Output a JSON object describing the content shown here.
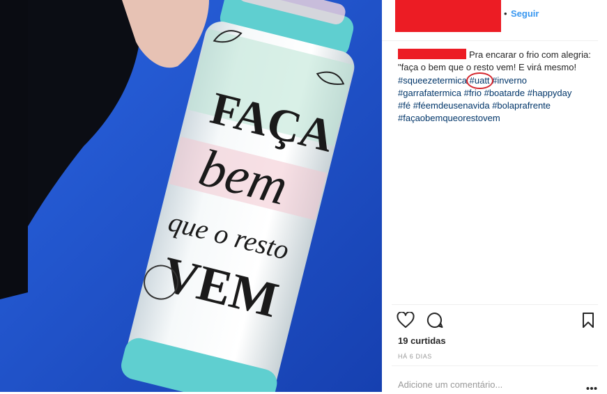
{
  "header": {
    "separator": "•",
    "follow_label": "Seguir"
  },
  "caption": {
    "lines": [
      "Pra encarar o frio com alegria:",
      "\"faça o bem que o resto vem! E virá mesmo!"
    ],
    "hashtags": [
      "#squeezetermica",
      "#uatt",
      "#inverno",
      "#garrafatermica",
      "#frio",
      "#boatarde",
      "#happyday",
      "#fé",
      "#féemdeusenavida",
      "#bolaprafrente",
      "#façaobemqueorestovem"
    ]
  },
  "stats": {
    "likes": "19 curtidas",
    "timestamp": "HÁ 6 DIAS"
  },
  "comment": {
    "placeholder": "Adicione um comentário..."
  },
  "photo": {
    "bottle_text": [
      "FAÇA",
      "bem",
      "que o resto",
      "VEM"
    ]
  },
  "icons": {
    "like": "heart-icon",
    "comment": "comment-bubble-icon",
    "save": "bookmark-icon",
    "more": "more-dots-icon"
  },
  "colors": {
    "link": "#3897f0",
    "hashtag": "#003569",
    "redaction": "#ec1c24",
    "annotation": "#d4262d",
    "background_photo": "#1a52c9",
    "bottle_cap": "#5fcfd0"
  }
}
